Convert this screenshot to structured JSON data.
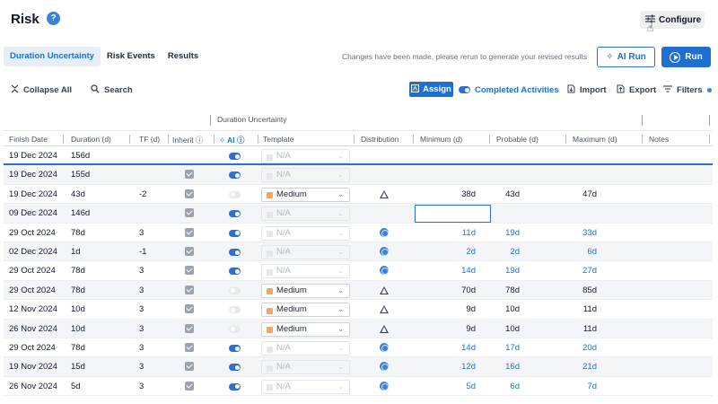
{
  "header": {
    "title": "Risk",
    "help_icon": "question-mark-icon",
    "configure_label": "Configure"
  },
  "tabs": [
    {
      "label": "Duration Uncertainty",
      "active": true
    },
    {
      "label": "Risk Events",
      "active": false
    },
    {
      "label": "Results",
      "active": false
    }
  ],
  "notice": "Changes have been made, please rerun to generate your revised results",
  "buttons": {
    "ai_run": "AI Run",
    "run": "Run"
  },
  "toolbar": {
    "collapse_all": "Collapse All",
    "search": "Search",
    "assign": "Assign",
    "completed_activities": "Completed Activities",
    "import": "Import",
    "export": "Export",
    "filters": "Filters"
  },
  "group_headers": {
    "duration_uncertainty": "Duration Uncertainty"
  },
  "columns": {
    "finish_date": "Finish Date",
    "duration": "Duration (d)",
    "tf": "TF (d)",
    "inherit": "Inherit",
    "ai": "AI",
    "template": "Template",
    "distribution": "Distribution",
    "minimum": "Minimum (d)",
    "probable": "Probable (d)",
    "maximum": "Maximum (d)",
    "notes": "Notes"
  },
  "colors": {
    "accent": "#1f6fd1",
    "medium_swatch": "#f5a65b"
  },
  "rows": [
    {
      "finish": "19 Dec 2024",
      "duration": "156d",
      "tf": "",
      "inherit": false,
      "ai": "on",
      "template": "N/A",
      "na": true,
      "dist": "",
      "min": "",
      "prob": "",
      "max": "",
      "ai_values": false,
      "selected": true
    },
    {
      "finish": "19 Dec 2024",
      "duration": "155d",
      "tf": "",
      "inherit": true,
      "ai": "on",
      "template": "N/A",
      "na": true,
      "dist": "",
      "min": "",
      "prob": "",
      "max": "",
      "ai_values": false
    },
    {
      "finish": "19 Dec 2024",
      "duration": "43d",
      "tf": "-2",
      "inherit": true,
      "ai": "off",
      "template": "Medium",
      "na": false,
      "dist": "triangle",
      "min": "38d",
      "prob": "43d",
      "max": "47d",
      "ai_values": false
    },
    {
      "finish": "09 Dec 2024",
      "duration": "146d",
      "tf": "",
      "inherit": true,
      "ai": "on",
      "template": "N/A",
      "na": true,
      "dist": "",
      "min": "",
      "prob": "",
      "max": "",
      "ai_values": false,
      "editing": true
    },
    {
      "finish": "29 Oct 2024",
      "duration": "78d",
      "tf": "3",
      "inherit": true,
      "ai": "on",
      "template": "N/A",
      "na": true,
      "dist": "ai",
      "min": "11d",
      "prob": "19d",
      "max": "33d",
      "ai_values": true
    },
    {
      "finish": "02 Dec 2024",
      "duration": "1d",
      "tf": "-1",
      "inherit": true,
      "ai": "on",
      "template": "N/A",
      "na": true,
      "dist": "ai",
      "min": "2d",
      "prob": "2d",
      "max": "6d",
      "ai_values": true
    },
    {
      "finish": "29 Oct 2024",
      "duration": "78d",
      "tf": "3",
      "inherit": true,
      "ai": "on",
      "template": "N/A",
      "na": true,
      "dist": "ai",
      "min": "14d",
      "prob": "19d",
      "max": "27d",
      "ai_values": true
    },
    {
      "finish": "29 Oct 2024",
      "duration": "78d",
      "tf": "3",
      "inherit": true,
      "ai": "off",
      "template": "Medium",
      "na": false,
      "dist": "triangle",
      "min": "70d",
      "prob": "78d",
      "max": "85d",
      "ai_values": false
    },
    {
      "finish": "12 Nov 2024",
      "duration": "10d",
      "tf": "3",
      "inherit": true,
      "ai": "off",
      "template": "Medium",
      "na": false,
      "dist": "triangle",
      "min": "9d",
      "prob": "10d",
      "max": "11d",
      "ai_values": false
    },
    {
      "finish": "26 Nov 2024",
      "duration": "10d",
      "tf": "3",
      "inherit": true,
      "ai": "off",
      "template": "Medium",
      "na": false,
      "dist": "triangle",
      "min": "9d",
      "prob": "10d",
      "max": "11d",
      "ai_values": false
    },
    {
      "finish": "29 Oct 2024",
      "duration": "78d",
      "tf": "3",
      "inherit": true,
      "ai": "on",
      "template": "N/A",
      "na": true,
      "dist": "ai",
      "min": "14d",
      "prob": "17d",
      "max": "20d",
      "ai_values": true
    },
    {
      "finish": "19 Nov 2024",
      "duration": "15d",
      "tf": "3",
      "inherit": true,
      "ai": "on",
      "template": "N/A",
      "na": true,
      "dist": "ai",
      "min": "12d",
      "prob": "16d",
      "max": "21d",
      "ai_values": true
    },
    {
      "finish": "26 Nov 2024",
      "duration": "5d",
      "tf": "3",
      "inherit": true,
      "ai": "on",
      "template": "N/A",
      "na": true,
      "dist": "ai",
      "min": "5d",
      "prob": "6d",
      "max": "7d",
      "ai_values": true
    }
  ]
}
